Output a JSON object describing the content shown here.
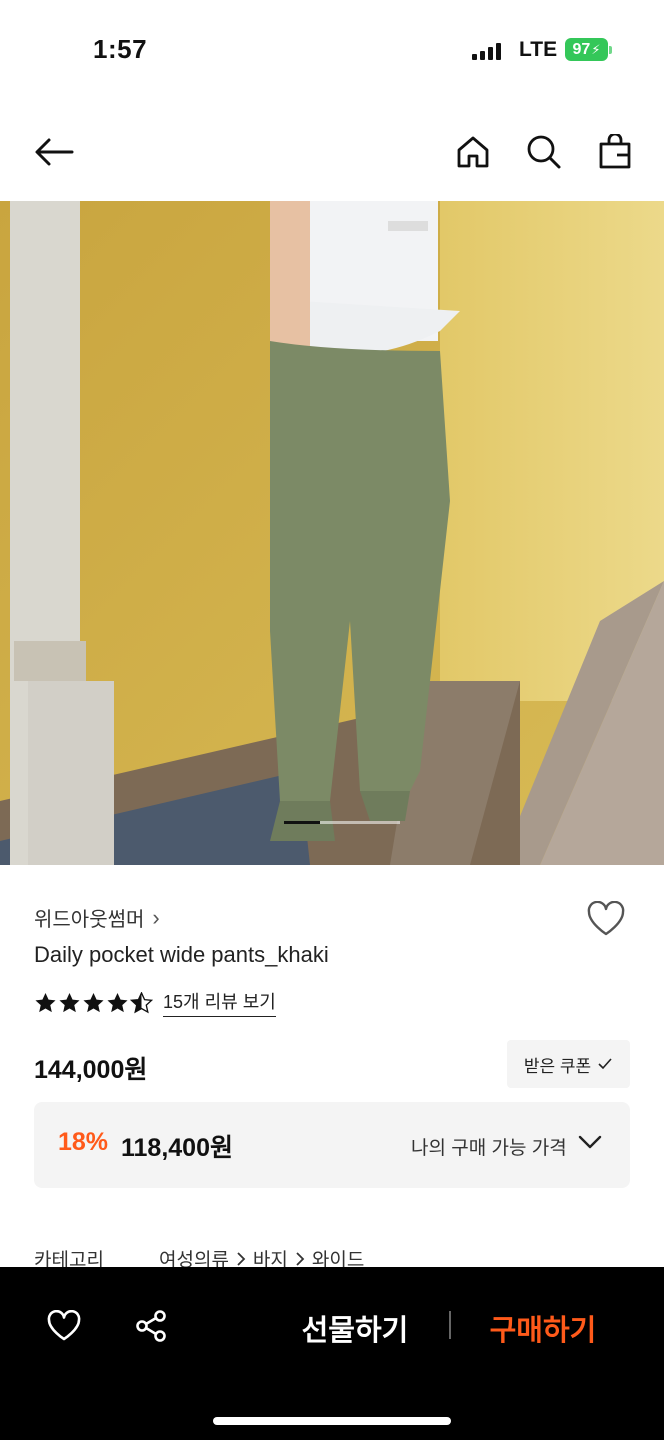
{
  "status_bar": {
    "time": "1:57",
    "network": "LTE",
    "battery": "97"
  },
  "nav": {
    "back_icon": "arrow-left-icon",
    "home_icon": "home-icon",
    "search_icon": "search-icon",
    "cart_icon": "shopping-bag-icon"
  },
  "product": {
    "brand": "위드아웃썸머",
    "brand_chevron": "›",
    "name": "Daily pocket wide pants_khaki",
    "rating": 4.5,
    "review_link": "15개 리뷰 보기",
    "price": "144,000원",
    "coupon_button": "받은 쿠폰",
    "discount_rate": "18%",
    "discount_price": "118,400원",
    "discount_label": "나의 구매 가능 가격",
    "category_label": "카테고리",
    "category_path": [
      "여성의류",
      "바지",
      "와이드"
    ],
    "image_index": 1,
    "image_count": 3
  },
  "bottom_bar": {
    "gift_label": "선물하기",
    "buy_label": "구매하기"
  },
  "colors": {
    "accent": "#ff5a1a",
    "battery": "#34c759",
    "bottom_bar": "#000000"
  }
}
